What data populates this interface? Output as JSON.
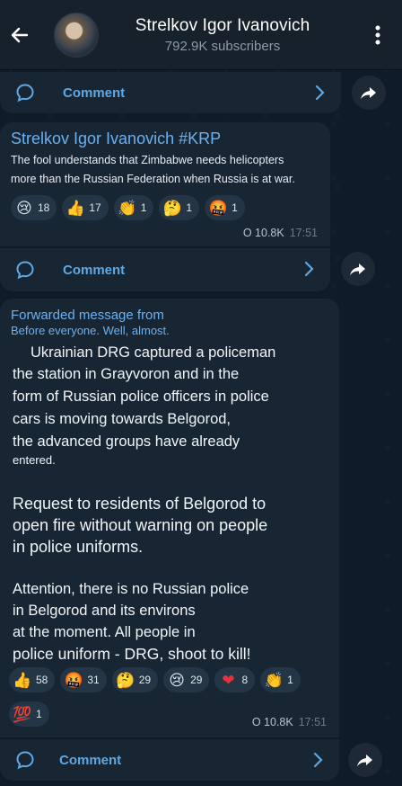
{
  "header": {
    "title": "Strelkov Igor Ivanovich",
    "subscribers": "792.9K subscribers"
  },
  "comment_label": "Comment",
  "post1": {
    "sender": "Strelkov Igor Ivanovich #KRP",
    "text_line1": "The fool understands that Zimbabwe needs helicopters",
    "text_line2": "more than the Russian Federation when Russia is at war.",
    "reactions": [
      {
        "emoji": "😢",
        "count": "18"
      },
      {
        "emoji": "👍",
        "count": "17"
      },
      {
        "emoji": "👏",
        "count": "1"
      },
      {
        "emoji": "🤔",
        "count": "1"
      },
      {
        "emoji": "🤬",
        "count": "1"
      }
    ],
    "views": "10.8K",
    "time": "17:51"
  },
  "post2": {
    "forwarded_label": "Forwarded message from",
    "forwarded_from": "Before everyone. Well, almost.",
    "lines": [
      "Ukrainian DRG captured a policeman",
      "the station in Grayvoron and in the",
      "form of Russian police officers in police",
      "cars is moving towards Belgorod,",
      "the advanced groups have already",
      "entered.",
      "Request to residents of Belgorod to",
      "open fire without warning on people",
      "in police uniforms.",
      "Attention, there is no Russian police",
      "in Belgorod and its environs",
      "at the moment. All people in",
      "police uniform - DRG, shoot to kill!"
    ],
    "reactions": [
      {
        "emoji": "👍",
        "count": "58"
      },
      {
        "emoji": "🤬",
        "count": "31"
      },
      {
        "emoji": "🤔",
        "count": "29"
      },
      {
        "emoji": "😢",
        "count": "29"
      },
      {
        "emoji": "❤",
        "count": "8"
      },
      {
        "emoji": "👏",
        "count": "1"
      },
      {
        "emoji": "💯",
        "count": "1"
      }
    ],
    "views": "10.8K",
    "time": "17:51"
  },
  "colors": {
    "accent": "#6cb0ef",
    "bubble": "#182533",
    "header": "#17212b"
  }
}
